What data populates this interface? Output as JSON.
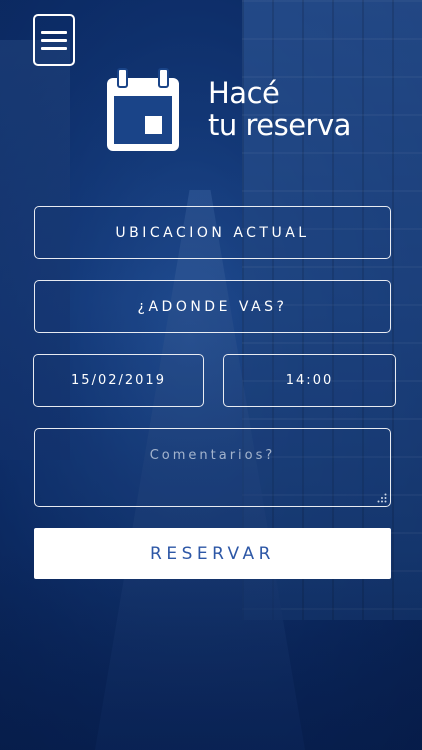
{
  "menu": {
    "icon": "hamburger-menu-icon"
  },
  "header": {
    "icon": "calendar-icon",
    "title_line1": "Hacé",
    "title_line2": "tu reserva"
  },
  "form": {
    "location_placeholder": "UBICACION ACTUAL",
    "destination_placeholder": "¿ADONDE VAS?",
    "date_value": "15/02/2019",
    "time_value": "14:00",
    "comments_placeholder": "Comentarios?",
    "submit_label": "RESERVAR"
  },
  "colors": {
    "background_tint": "#1a4488",
    "button_text": "#2d57a6",
    "button_bg": "#ffffff",
    "field_border": "#ffffff"
  }
}
